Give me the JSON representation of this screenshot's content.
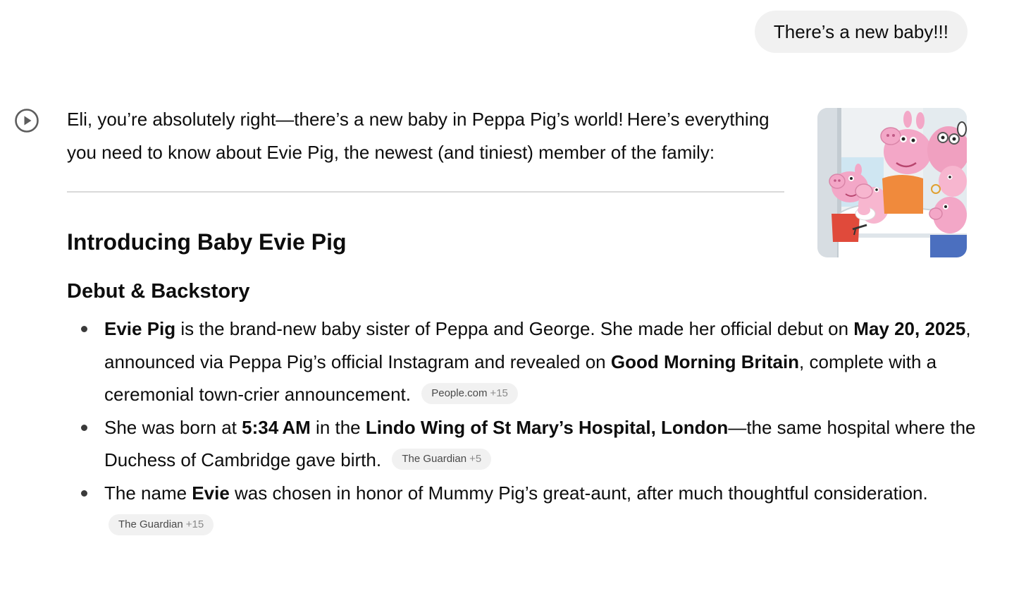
{
  "user_message": "There’s a new baby!!!",
  "icons": {
    "play": "play-circle-icon"
  },
  "response": {
    "intro": "Eli, you’re absolutely right—there’s a new baby in Peppa Pig’s world! Here’s everything you need to know about Evie Pig, the newest (and tiniest) member of the family:",
    "heading": "Introducing Baby Evie Pig",
    "subheading": "Debut & Backstory",
    "bullets": [
      {
        "parts": [
          {
            "text": "Evie Pig",
            "bold": true
          },
          {
            "text": " is the brand-new baby sister of Peppa and George. She made her official debut on ",
            "bold": false
          },
          {
            "text": "May 20, 2025",
            "bold": true
          },
          {
            "text": ", announced via Peppa Pig’s official Instagram and revealed on ",
            "bold": false
          },
          {
            "text": "Good Morning Britain",
            "bold": true
          },
          {
            "text": ", complete with a ceremonial town-crier announcement.",
            "bold": false
          }
        ],
        "source": {
          "name": "People.com",
          "more": "+15"
        }
      },
      {
        "parts": [
          {
            "text": "She was born at ",
            "bold": false
          },
          {
            "text": "5:34 AM",
            "bold": true
          },
          {
            "text": " in the ",
            "bold": false
          },
          {
            "text": "Lindo Wing of St Mary’s Hospital, London",
            "bold": true
          },
          {
            "text": "—the same hospital where the Duchess of Cambridge gave birth.",
            "bold": false
          }
        ],
        "source": {
          "name": "The Guardian",
          "more": "+5"
        }
      },
      {
        "parts": [
          {
            "text": "The name ",
            "bold": false
          },
          {
            "text": "Evie",
            "bold": true
          },
          {
            "text": " was chosen in honor of Mummy Pig’s great-aunt, after much thoughtful consideration.",
            "bold": false
          }
        ],
        "source": {
          "name": "The Guardian",
          "more": "+15"
        }
      }
    ]
  },
  "thumbnail": {
    "subject": "Peppa Pig family illustration with newborn"
  },
  "colors": {
    "bubble_bg": "#f1f1f1",
    "chip_bg": "#f1f1f1",
    "peppa_pink": "#f4a3c3",
    "text": "#0d0d0d"
  }
}
